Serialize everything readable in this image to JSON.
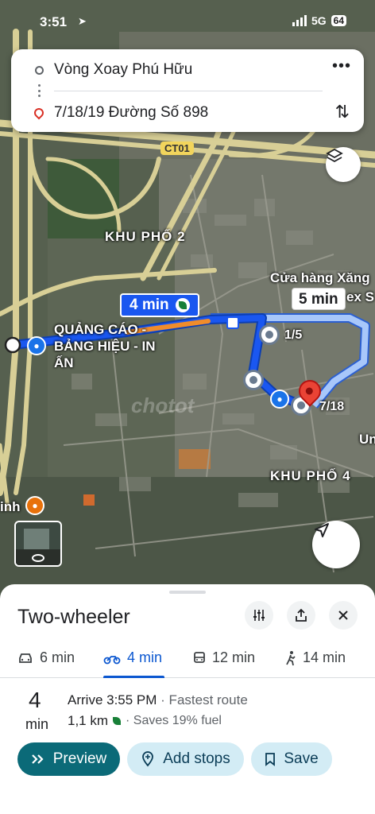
{
  "status_bar": {
    "time": "3:51",
    "network": "5G",
    "battery": "64"
  },
  "directions": {
    "origin": "Vòng Xoay Phú Hữu",
    "destination": "7/18/19 Đường Số 898"
  },
  "map": {
    "road_label": "CT01",
    "area_1": "KHU PHỐ 2",
    "area_2": "KHU PHỐ 4",
    "poi_1": "QUẢNG CÁO - BẢNG HIỆU - IN ẤN",
    "poi_2": "Cửa hàng Xăng",
    "poi_2_cut": "ex S",
    "pin_label_1": "1/5",
    "pin_label_2": "7/18",
    "edge_label_right": "Un",
    "edge_label_left": "inh",
    "route_main_time": "4 min",
    "route_alt_time": "5 min",
    "watermark": "chotot",
    "route_color": "#1a57f0",
    "alt_route_color": "#a8c7fa"
  },
  "sheet": {
    "title": "Two-wheeler",
    "modes": [
      {
        "icon": "car-icon",
        "label": "6 min"
      },
      {
        "icon": "motorbike-icon",
        "label": "4 min",
        "active": true
      },
      {
        "icon": "transit-icon",
        "label": "12 min"
      },
      {
        "icon": "walk-icon",
        "label": "14 min"
      }
    ],
    "duration_value": "4",
    "duration_unit": "min",
    "arrive": "Arrive 3:55 PM",
    "route_note": "· Fastest route",
    "distance": "1,1 km",
    "fuel_note": "· Saves 19% fuel",
    "buttons": {
      "preview": "Preview",
      "add_stops": "Add stops",
      "save": "Save"
    },
    "accent": "#0b6a78"
  }
}
